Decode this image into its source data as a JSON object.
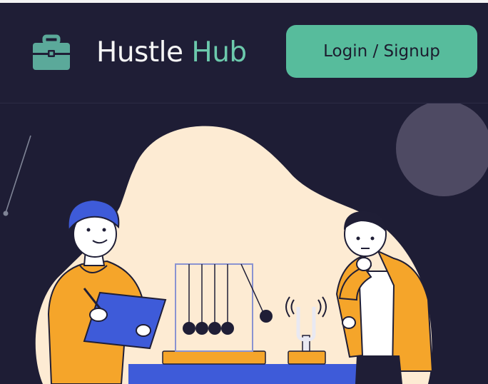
{
  "header": {
    "logo_icon": "briefcase-icon",
    "brand_part1": "Hustle",
    "brand_part2": "Hub",
    "login_label": "Login / Signup"
  },
  "hero": {
    "illustration": "two-people-newtons-cradle-illustration",
    "colors": {
      "background": "#1e1d35",
      "blob": "#fdebd3",
      "accent": "#57bc9c",
      "shirt": "#f5a52a",
      "clipboard": "#3d5be0"
    }
  }
}
